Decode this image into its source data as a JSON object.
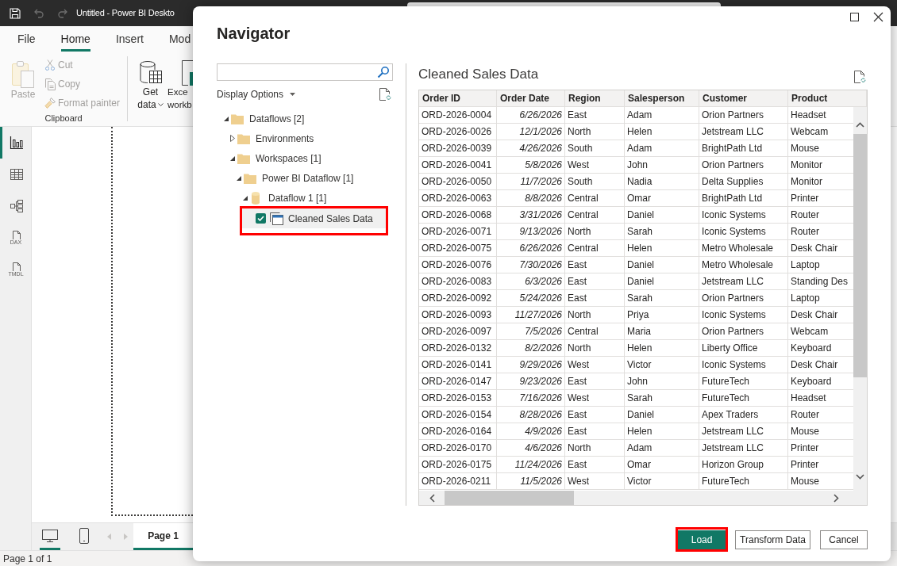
{
  "app": {
    "quick_access": [
      {
        "kind": "save",
        "disabled": false
      },
      {
        "kind": "undo",
        "disabled": true
      },
      {
        "kind": "redo",
        "disabled": true
      }
    ],
    "title": "Untitled - Power BI Deskto",
    "ribbon_tabs": [
      {
        "label": "File",
        "selected": false
      },
      {
        "label": "Home",
        "selected": true
      },
      {
        "label": "Insert",
        "selected": false
      },
      {
        "label": "Mod",
        "selected": false
      }
    ],
    "clipboard_group": {
      "label": "Clipboard",
      "paste": {
        "label": "Paste",
        "disabled": true
      },
      "commands": [
        {
          "kind": "cut",
          "label": "Cut",
          "disabled": true
        },
        {
          "kind": "copy",
          "label": "Copy",
          "disabled": true
        },
        {
          "kind": "format-painter",
          "label": "Format painter",
          "disabled": true
        }
      ]
    },
    "data_group": [
      {
        "kind": "get-data",
        "lines": [
          "Get",
          "data"
        ],
        "dropdown": true
      },
      {
        "kind": "excel",
        "lines": [
          "Exce",
          "workb"
        ],
        "dropdown": false
      }
    ],
    "views": [
      {
        "kind": "report",
        "selected": true
      },
      {
        "kind": "table",
        "selected": false
      },
      {
        "kind": "model",
        "selected": false
      },
      {
        "kind": "dax",
        "label": "DAX",
        "selected": false
      },
      {
        "kind": "tmdl",
        "label": "TMDL",
        "selected": false
      }
    ],
    "layouts": [
      {
        "kind": "desktop",
        "selected": true
      },
      {
        "kind": "phone",
        "selected": false
      }
    ],
    "pages": [
      {
        "label": "Page 1",
        "selected": true
      }
    ],
    "status_bar": "Page 1 of 1"
  },
  "navigator": {
    "title": "Navigator",
    "display_options": "Display Options",
    "tree": [
      {
        "label": "Dataflows [2]",
        "kind": "folder",
        "expanded": true,
        "selected": false,
        "highlighted": false,
        "children": [
          {
            "label": "Environments",
            "kind": "folder",
            "expanded": false,
            "selected": false,
            "highlighted": false
          },
          {
            "label": "Workspaces [1]",
            "kind": "folder",
            "expanded": true,
            "selected": false,
            "highlighted": false,
            "children": [
              {
                "label": "Power BI Dataflow [1]",
                "kind": "folder",
                "expanded": true,
                "selected": false,
                "highlighted": false,
                "children": [
                  {
                    "label": "Dataflow 1 [1]",
                    "kind": "dataflow",
                    "expanded": true,
                    "selected": false,
                    "highlighted": false,
                    "children": [
                      {
                        "label": "Cleaned Sales Data",
                        "kind": "table",
                        "checked": true,
                        "selected": true,
                        "highlighted": true
                      }
                    ]
                  }
                ]
              }
            ]
          }
        ]
      }
    ],
    "preview": {
      "title": "Cleaned Sales Data",
      "columns": [
        {
          "label": "Order ID",
          "kind": "text"
        },
        {
          "label": "Order Date",
          "kind": "date"
        },
        {
          "label": "Region",
          "kind": "text"
        },
        {
          "label": "Salesperson",
          "kind": "text"
        },
        {
          "label": "Customer",
          "kind": "text"
        },
        {
          "label": "Product",
          "kind": "text"
        }
      ],
      "rows": [
        [
          "ORD-2026-0004",
          "6/26/2026",
          "East",
          "Adam",
          "Orion Partners",
          "Headset"
        ],
        [
          "ORD-2026-0026",
          "12/1/2026",
          "North",
          "Helen",
          "Jetstream LLC",
          "Webcam"
        ],
        [
          "ORD-2026-0039",
          "4/26/2026",
          "South",
          "Adam",
          "BrightPath Ltd",
          "Mouse"
        ],
        [
          "ORD-2026-0041",
          "5/8/2026",
          "West",
          "John",
          "Orion Partners",
          "Monitor"
        ],
        [
          "ORD-2026-0050",
          "11/7/2026",
          "South",
          "Nadia",
          "Delta Supplies",
          "Monitor"
        ],
        [
          "ORD-2026-0063",
          "8/8/2026",
          "Central",
          "Omar",
          "BrightPath Ltd",
          "Printer"
        ],
        [
          "ORD-2026-0068",
          "3/31/2026",
          "Central",
          "Daniel",
          "Iconic Systems",
          "Router"
        ],
        [
          "ORD-2026-0071",
          "9/13/2026",
          "North",
          "Sarah",
          "Iconic Systems",
          "Router"
        ],
        [
          "ORD-2026-0075",
          "6/26/2026",
          "Central",
          "Helen",
          "Metro Wholesale",
          "Desk Chair"
        ],
        [
          "ORD-2026-0076",
          "7/30/2026",
          "East",
          "Daniel",
          "Metro Wholesale",
          "Laptop"
        ],
        [
          "ORD-2026-0083",
          "6/3/2026",
          "East",
          "Daniel",
          "Jetstream LLC",
          "Standing Des"
        ],
        [
          "ORD-2026-0092",
          "5/24/2026",
          "East",
          "Sarah",
          "Orion Partners",
          "Laptop"
        ],
        [
          "ORD-2026-0093",
          "11/27/2026",
          "North",
          "Priya",
          "Iconic Systems",
          "Desk Chair"
        ],
        [
          "ORD-2026-0097",
          "7/5/2026",
          "Central",
          "Maria",
          "Orion Partners",
          "Webcam"
        ],
        [
          "ORD-2026-0132",
          "8/2/2026",
          "North",
          "Helen",
          "Liberty Office",
          "Keyboard"
        ],
        [
          "ORD-2026-0141",
          "9/29/2026",
          "West",
          "Victor",
          "Iconic Systems",
          "Desk Chair"
        ],
        [
          "ORD-2026-0147",
          "9/23/2026",
          "East",
          "John",
          "FutureTech",
          "Keyboard"
        ],
        [
          "ORD-2026-0153",
          "7/16/2026",
          "West",
          "Sarah",
          "FutureTech",
          "Headset"
        ],
        [
          "ORD-2026-0154",
          "8/28/2026",
          "East",
          "Daniel",
          "Apex Traders",
          "Router"
        ],
        [
          "ORD-2026-0164",
          "4/9/2026",
          "East",
          "Helen",
          "Jetstream LLC",
          "Mouse"
        ],
        [
          "ORD-2026-0170",
          "4/6/2026",
          "North",
          "Adam",
          "Jetstream LLC",
          "Printer"
        ],
        [
          "ORD-2026-0175",
          "11/24/2026",
          "East",
          "Omar",
          "Horizon Group",
          "Printer"
        ],
        [
          "ORD-2026-0211",
          "11/5/2026",
          "West",
          "Victor",
          "FutureTech",
          "Mouse"
        ]
      ]
    },
    "buttons": [
      {
        "label": "Load",
        "kind": "primary",
        "highlighted": true
      },
      {
        "label": "Transform Data",
        "kind": "secondary",
        "highlighted": false
      },
      {
        "label": "Cancel",
        "kind": "secondary",
        "highlighted": false
      }
    ]
  }
}
